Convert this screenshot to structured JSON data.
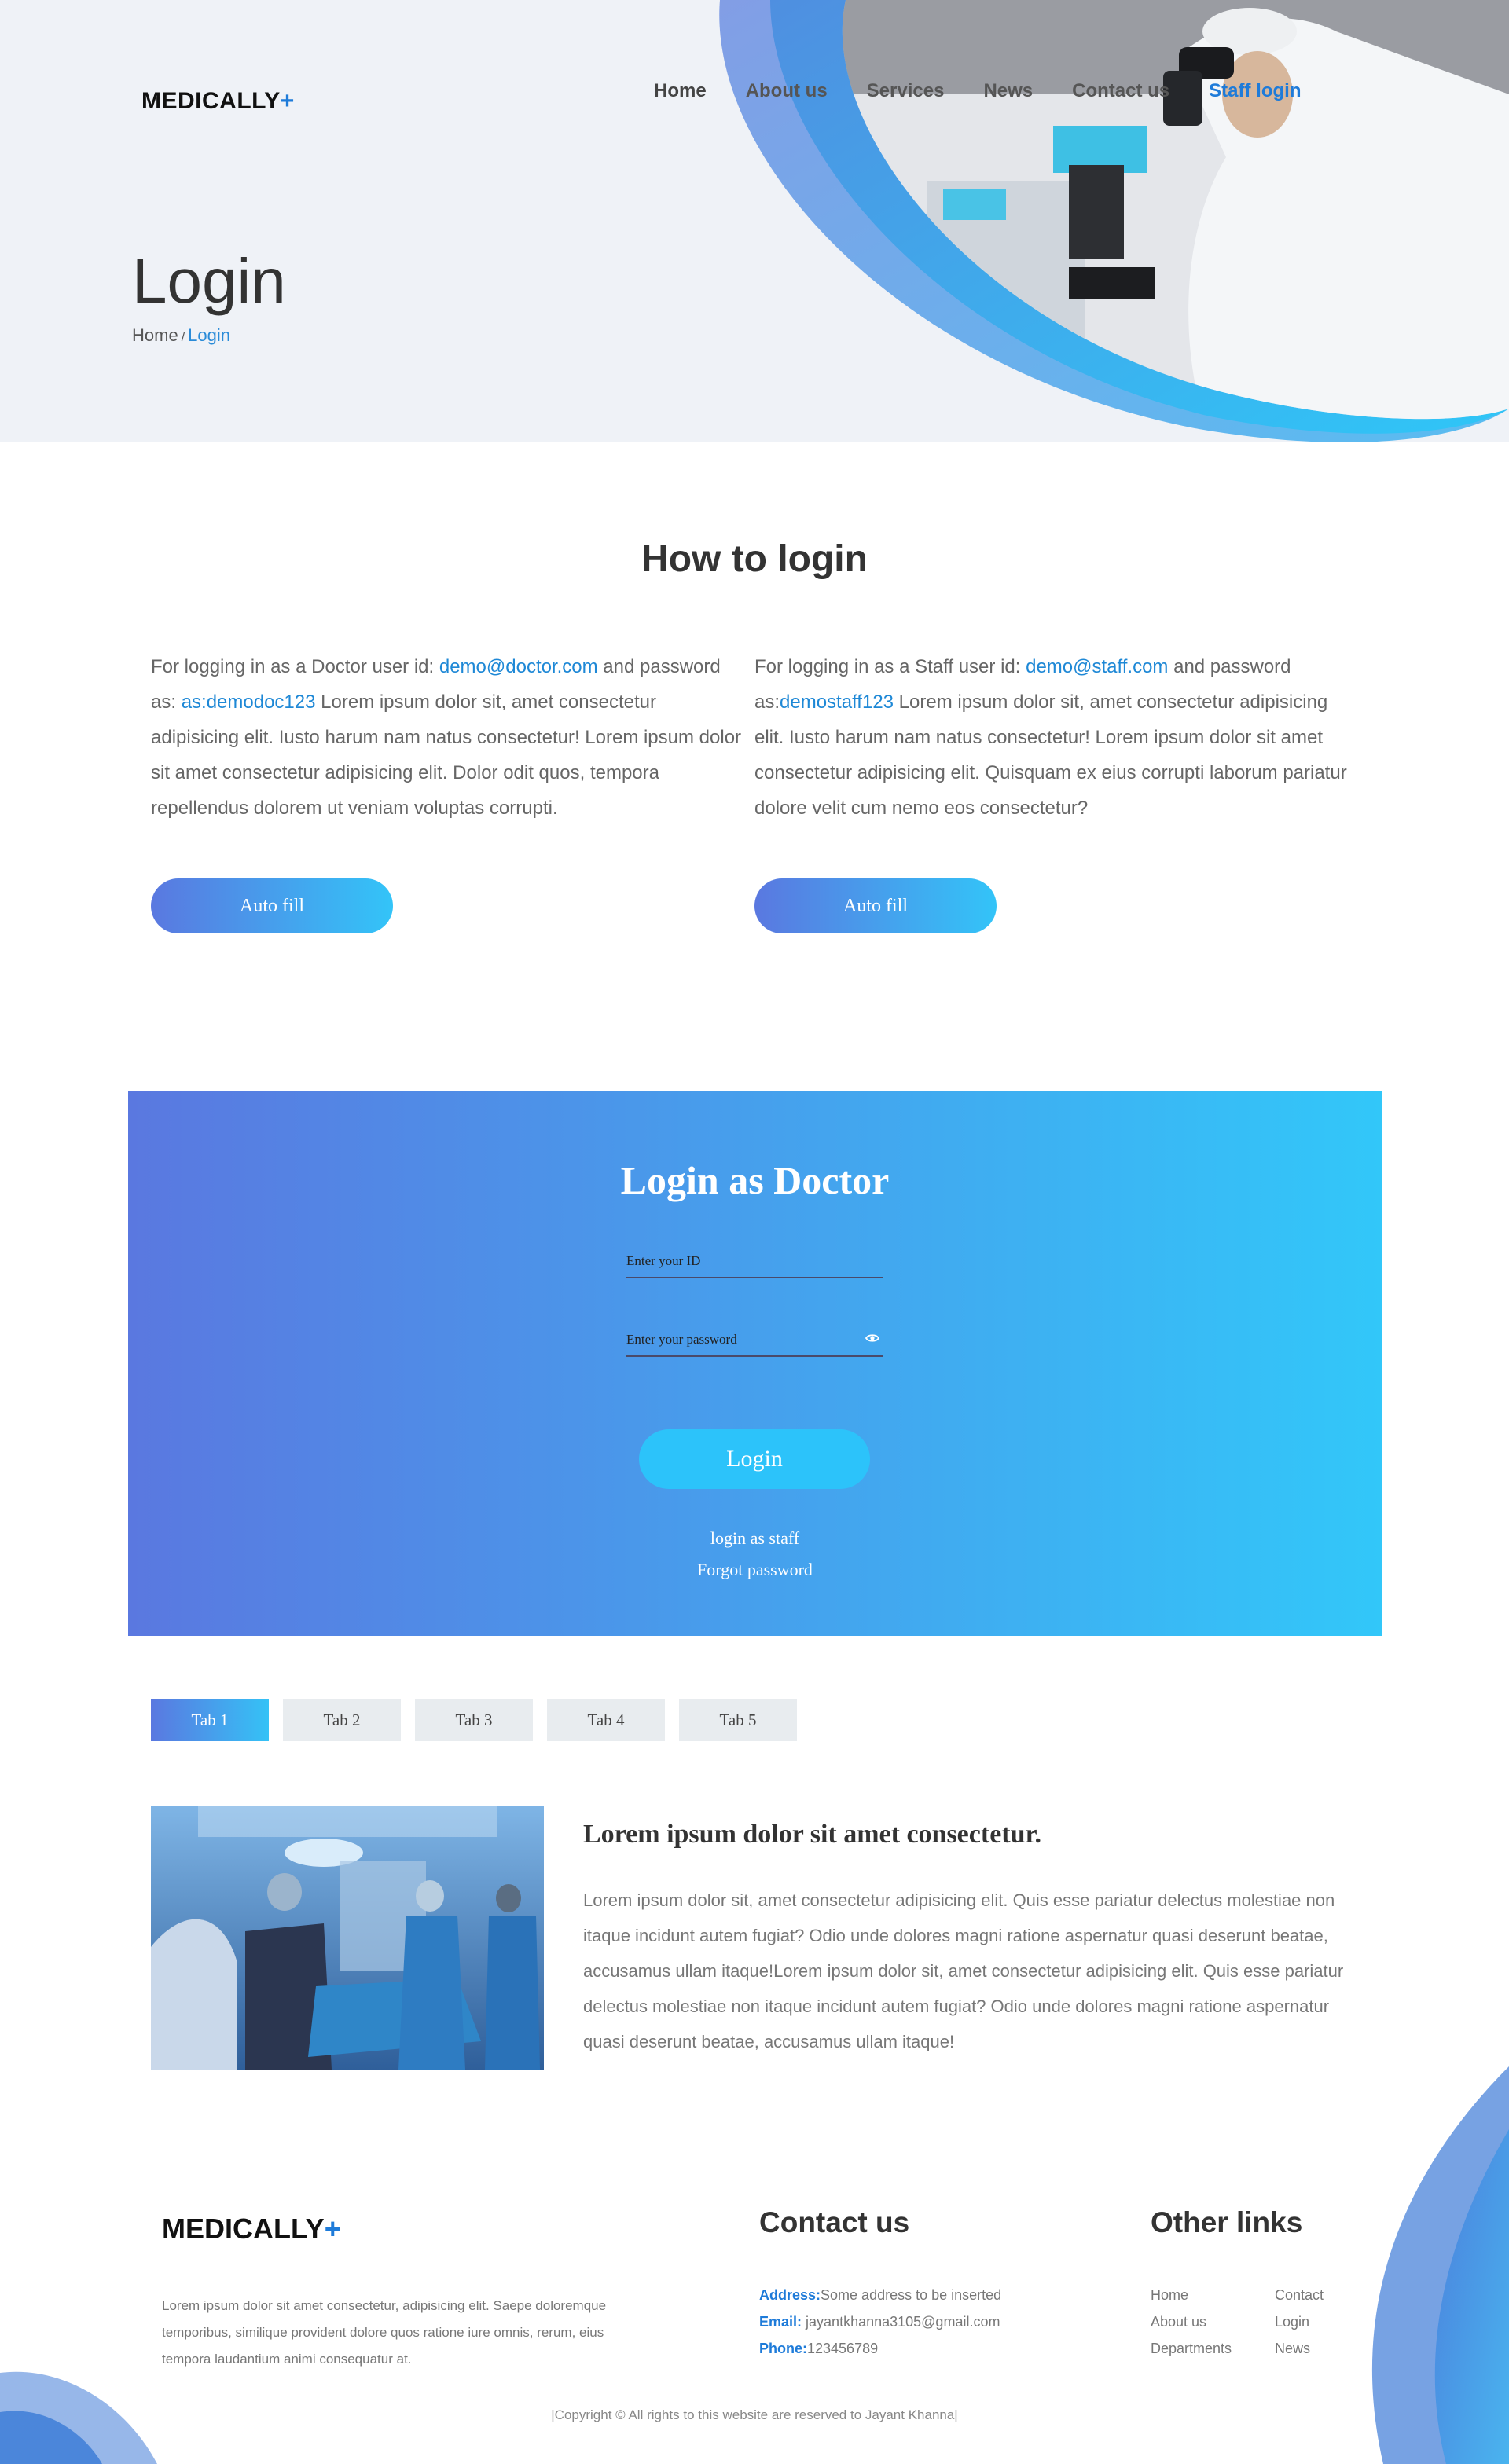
{
  "header": {
    "logo_text": "MEDICALLY",
    "logo_plus": "+",
    "nav": [
      {
        "label": "Home"
      },
      {
        "label": "About us"
      },
      {
        "label": "Services"
      },
      {
        "label": "News"
      },
      {
        "label": "Contact us"
      },
      {
        "label": "Staff login"
      }
    ],
    "active_nav": "Staff login",
    "page_title": "Login",
    "breadcrumb": {
      "home": "Home",
      "separator": "/",
      "current": "Login"
    }
  },
  "how_to": {
    "title": "How to login",
    "doctor": {
      "prefix": "For logging in as a Doctor user id: ",
      "user_id": "demo@doctor.com",
      "mid": " and password as: ",
      "password": "as:demodoc123",
      "suffix": " Lorem ipsum dolor sit, amet consectetur adipisicing elit. Iusto harum nam natus consectetur! Lorem ipsum dolor sit amet consectetur adipisicing elit. Dolor odit quos, tempora repellendus dolorem ut veniam voluptas corrupti.",
      "button": "Auto fill"
    },
    "staff": {
      "prefix": "For logging in as a Staff user id: ",
      "user_id": "demo@staff.com",
      "mid": " and password as:",
      "password": "demostaff123",
      "suffix": " Lorem ipsum dolor sit, amet consectetur adipisicing elit. Iusto harum nam natus consectetur! Lorem ipsum dolor sit amet consectetur adipisicing elit. Quisquam ex eius corrupti laborum pariatur dolore velit cum nemo eos consectetur?",
      "button": "Auto fill"
    }
  },
  "login_form": {
    "title": "Login as Doctor",
    "id_placeholder": "Enter your ID",
    "password_placeholder": "Enter your password",
    "submit": "Login",
    "staff_link": "login as staff",
    "forgot_link": "Forgot password"
  },
  "tabs": {
    "items": [
      "Tab 1",
      "Tab 2",
      "Tab 3",
      "Tab 4",
      "Tab 5"
    ],
    "active": "Tab 1",
    "heading": "Lorem ipsum dolor sit amet consectetur.",
    "body": "Lorem ipsum dolor sit, amet consectetur adipisicing elit. Quis esse pariatur delectus molestiae non itaque incidunt autem fugiat? Odio unde dolores magni ratione aspernatur quasi deserunt beatae, accusamus ullam itaque!Lorem ipsum dolor sit, amet consectetur adipisicing elit. Quis esse pariatur delectus molestiae non itaque incidunt autem fugiat? Odio unde dolores magni ratione aspernatur quasi deserunt beatae, accusamus ullam itaque!"
  },
  "footer": {
    "logo_text": "MEDICALLY",
    "logo_plus": "+",
    "about": "Lorem ipsum dolor sit amet consectetur, adipisicing elit. Saepe doloremque temporibus, similique provident dolore quos ratione iure omnis, rerum, eius tempora laudantium animi consequatur at.",
    "contact_heading": "Contact us",
    "address_label": "Address:",
    "address_value": "Some address to be inserted",
    "email_label": "Email:",
    "email_value": " jayantkhanna3105@gmail.com",
    "phone_label": "Phone:",
    "phone_value": "123456789",
    "links_heading": "Other links",
    "links": [
      "Home",
      "Contact",
      "About us",
      "Login",
      "Departments",
      "News"
    ],
    "copyright": "|Copyright © All rights to this website are reserved to Jayant Khanna|"
  },
  "colors": {
    "brand_blue": "#1e7bd9",
    "gradient_start": "#5a78e0",
    "gradient_end": "#32c7f9",
    "hero_bg": "#eff2f7"
  }
}
